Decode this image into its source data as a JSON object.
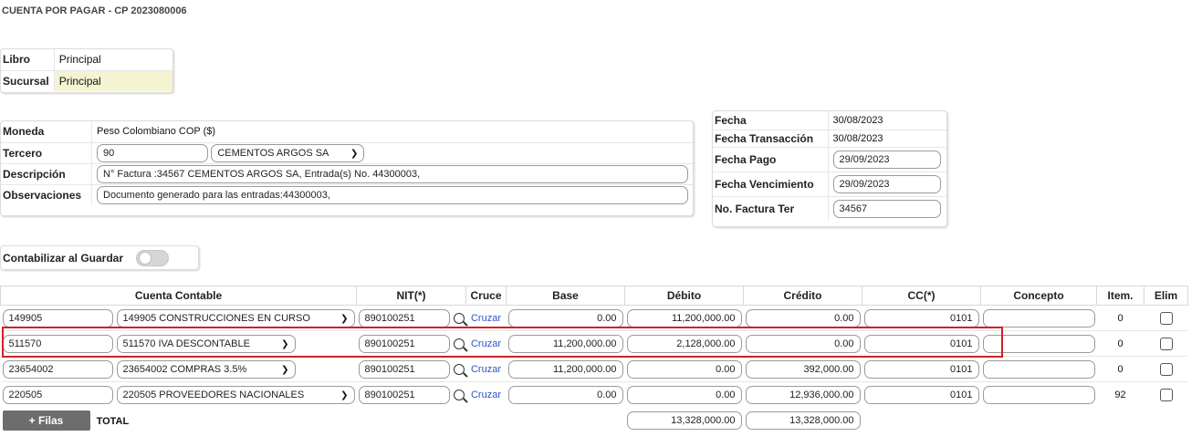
{
  "header": {
    "title": "CUENTA POR PAGAR - CP 2023080006"
  },
  "libro_panel": {
    "libro_label": "Libro",
    "libro_value": "Principal",
    "sucursal_label": "Sucursal",
    "sucursal_value": "Principal"
  },
  "info_panel": {
    "moneda_label": "Moneda",
    "moneda_value": "Peso Colombiano COP ($)",
    "tercero_label": "Tercero",
    "tercero_code": "90",
    "tercero_name": "CEMENTOS ARGOS SA",
    "descripcion_label": "Descripción",
    "descripcion_value": "N° Factura :34567 CEMENTOS ARGOS SA, Entrada(s) No. 44300003,",
    "observaciones_label": "Observaciones",
    "observaciones_value": "Documento generado para las entradas:44300003,"
  },
  "dates_panel": {
    "fecha_label": "Fecha",
    "fecha_value": "30/08/2023",
    "fecha_transaccion_label": "Fecha Transacción",
    "fecha_transaccion_value": "30/08/2023",
    "fecha_pago_label": "Fecha Pago",
    "fecha_pago_value": "29/09/2023",
    "fecha_vencimiento_label": "Fecha Vencimiento",
    "fecha_vencimiento_value": "29/09/2023",
    "factura_label": "No. Factura Ter",
    "factura_value": "34567"
  },
  "toggle": {
    "label": "Contabilizar al Guardar",
    "on": false
  },
  "grid": {
    "headers": [
      "Cuenta Contable",
      "NIT(*)",
      "Cruce",
      "Base",
      "Débito",
      "Crédito",
      "CC(*)",
      "Concepto",
      "Item.",
      "Elim"
    ],
    "rows": [
      {
        "code": "149905",
        "account": "149905 CONSTRUCCIONES EN CURSO",
        "nit": "890100251",
        "cruce": "Cruzar",
        "base": "0.00",
        "debito": "11,200,000.00",
        "credito": "0.00",
        "cc": "0101",
        "concepto": "",
        "item": "0"
      },
      {
        "code": "511570",
        "account": "511570 IVA DESCONTABLE",
        "nit": "890100251",
        "cruce": "Cruzar",
        "base": "11,200,000.00",
        "debito": "2,128,000.00",
        "credito": "0.00",
        "cc": "0101",
        "concepto": "",
        "item": "0"
      },
      {
        "code": "23654002",
        "account": "23654002 COMPRAS 3.5%",
        "nit": "890100251",
        "cruce": "Cruzar",
        "base": "11,200,000.00",
        "debito": "0.00",
        "credito": "392,000.00",
        "cc": "0101",
        "concepto": "",
        "item": "0"
      },
      {
        "code": "220505",
        "account": "220505 PROVEEDORES NACIONALES",
        "nit": "890100251",
        "cruce": "Cruzar",
        "base": "0.00",
        "debito": "0.00",
        "credito": "12,936,000.00",
        "cc": "0101",
        "concepto": "",
        "item": "92"
      }
    ],
    "add_rows_label": "+ Filas",
    "total_label": "TOTAL",
    "total_debito": "13,328,000.00",
    "total_credito": "13,328,000.00"
  },
  "colors": {
    "highlight": "#d0202a",
    "link": "#2f55c0",
    "sucursal_bg": "#f4f4d3"
  }
}
